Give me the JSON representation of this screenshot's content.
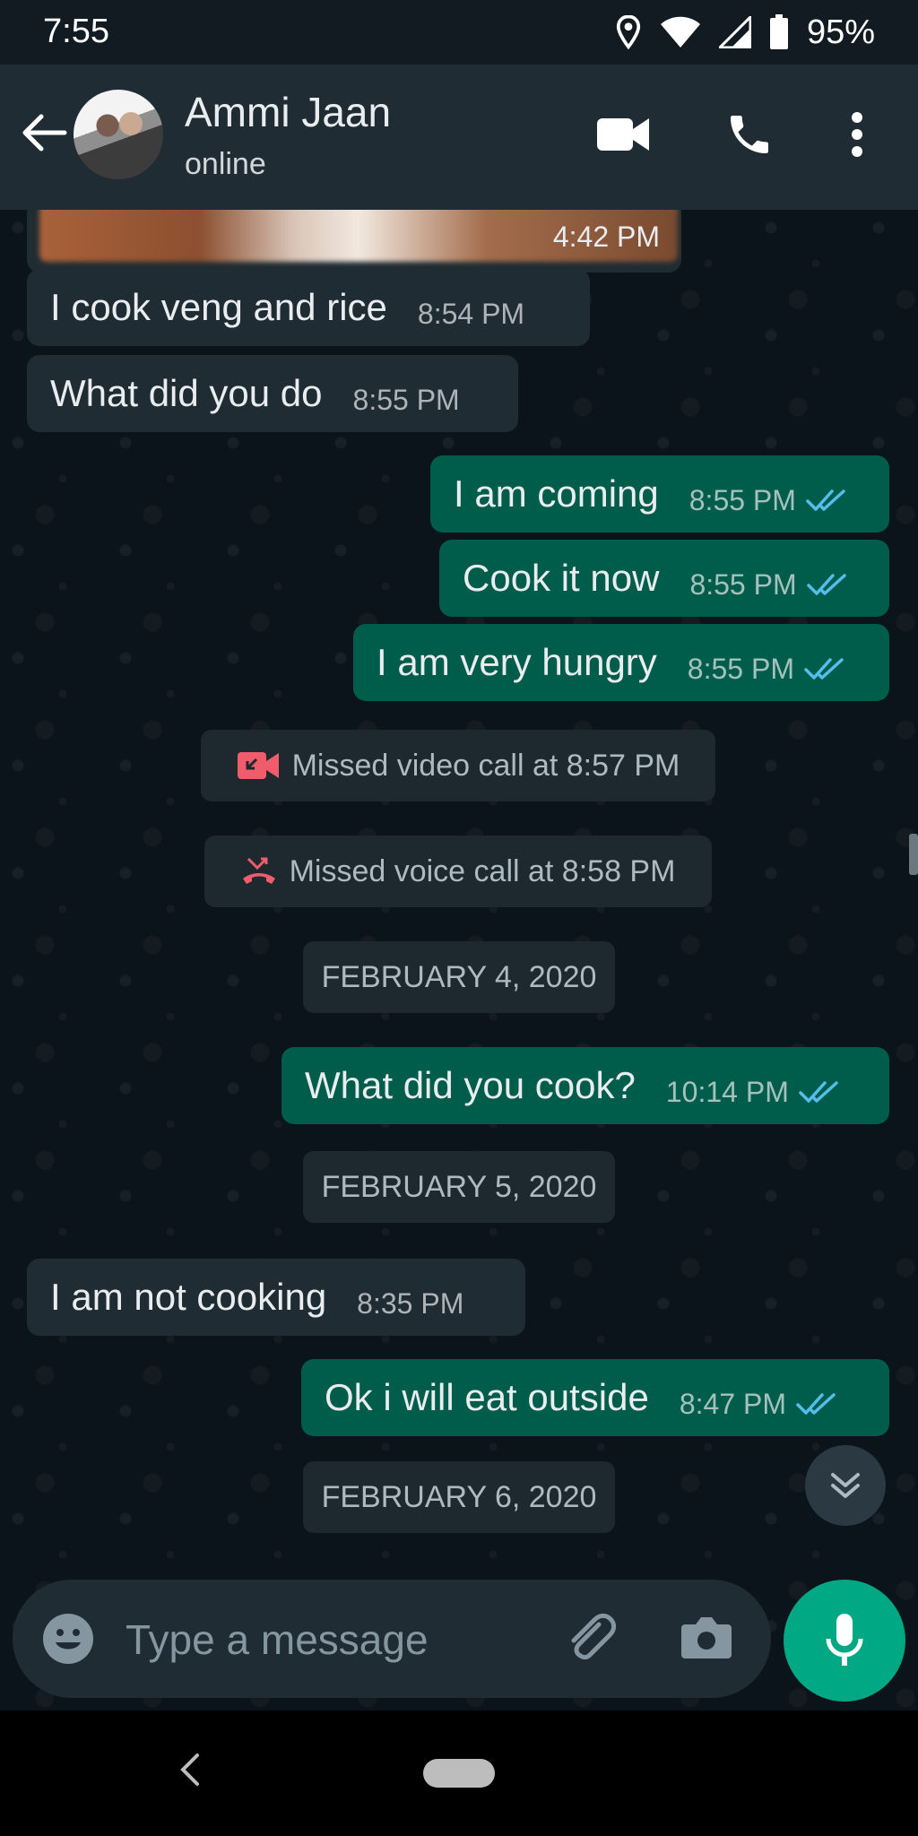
{
  "status_bar": {
    "time": "7:55",
    "battery": "95%"
  },
  "header": {
    "contact_name": "Ammi Jaan",
    "contact_status": "online"
  },
  "messages": [
    {
      "type": "image",
      "time": "4:42 PM"
    },
    {
      "dir": "in",
      "text": "I cook veng and rice",
      "time": "8:54 PM"
    },
    {
      "dir": "in",
      "text": "What did you do",
      "time": "8:55 PM"
    },
    {
      "dir": "out",
      "text": "I am coming",
      "time": "8:55 PM",
      "status": "read"
    },
    {
      "dir": "out",
      "text": "Cook it now",
      "time": "8:55 PM",
      "status": "read"
    },
    {
      "dir": "out",
      "text": "I am very hungry",
      "time": "8:55 PM",
      "status": "read"
    },
    {
      "type": "system",
      "icon": "missed-video-call-icon",
      "text": "Missed video call at 8:57 PM"
    },
    {
      "type": "system",
      "icon": "missed-voice-call-icon",
      "text": "Missed voice call at 8:58 PM"
    },
    {
      "type": "date",
      "text": "FEBRUARY 4, 2020"
    },
    {
      "dir": "out",
      "text": "What did you cook?",
      "time": "10:14 PM",
      "status": "read"
    },
    {
      "type": "date",
      "text": "FEBRUARY 5, 2020"
    },
    {
      "dir": "in",
      "text": "I am not cooking",
      "time": "8:35 PM"
    },
    {
      "dir": "out",
      "text": "Ok i will eat outside",
      "time": "8:47 PM",
      "status": "read"
    },
    {
      "type": "date",
      "text": "FEBRUARY 6, 2020"
    }
  ],
  "input": {
    "placeholder": "Type a message"
  },
  "colors": {
    "header": "#1f2c33",
    "chat_background": "#0b141a",
    "incoming_bubble": "#202c33",
    "outgoing_bubble": "#005c4b",
    "read_ticks": "#53bdeb",
    "missed_call": "#f15c6d",
    "mic_button": "#00a884"
  },
  "icons": [
    "back-arrow-icon",
    "video-call-icon",
    "voice-call-icon",
    "more-options-icon",
    "emoji-icon",
    "attach-icon",
    "camera-icon",
    "mic-icon",
    "scroll-down-icon"
  ]
}
